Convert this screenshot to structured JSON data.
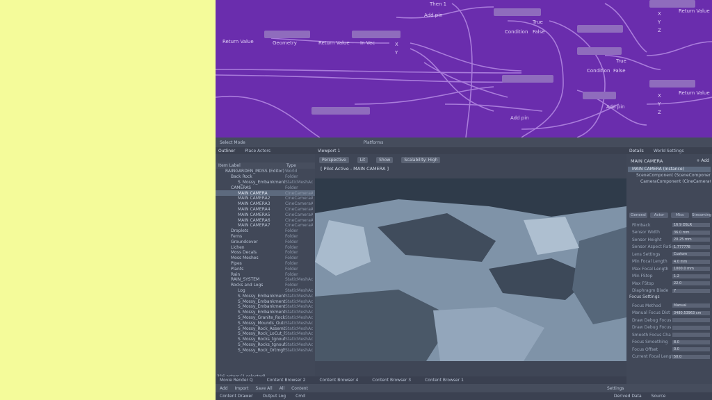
{
  "graph": {
    "nodes": [
      "Then 1",
      "Add pin",
      "Return Value",
      "Geometry",
      "Return Value",
      "In Vec",
      "X",
      "Y",
      "True",
      "Condition",
      "False",
      "True",
      "Condition",
      "False",
      "Add pin",
      "Add pin",
      "Return Value",
      "Return Value",
      "X",
      "Y",
      "Z",
      "X",
      "Y",
      "Z"
    ]
  },
  "toolbar": {
    "select_mode": "Select Mode",
    "platforms": "Platforms"
  },
  "outliner": {
    "tab_outliner": "Outliner",
    "tab_place": "Place Actors",
    "col_label": "Item Label",
    "col_type": "Type",
    "rows": [
      {
        "name": "RAINGARDEN_MOSS (Editor)",
        "type": "World"
      },
      {
        "name": "Back Rock",
        "type": "Folder"
      },
      {
        "name": "S_Mossy_Embankment_Coastal",
        "type": "StaticMeshAct"
      },
      {
        "name": "CAMERAS",
        "type": "Folder"
      },
      {
        "name": "MAIN CAMERA",
        "type": "CineCameraAct"
      },
      {
        "name": "MAIN CAMERA2",
        "type": "CineCameraAct"
      },
      {
        "name": "MAIN CAMERA3",
        "type": "CineCameraAct"
      },
      {
        "name": "MAIN CAMERA4",
        "type": "CineCameraAct"
      },
      {
        "name": "MAIN CAMERA5",
        "type": "CineCameraAct"
      },
      {
        "name": "MAIN CAMERA6",
        "type": "CineCameraAct"
      },
      {
        "name": "MAIN CAMERA7",
        "type": "CineCameraAct"
      },
      {
        "name": "Droplets",
        "type": "Folder"
      },
      {
        "name": "Ferns",
        "type": "Folder"
      },
      {
        "name": "Groundcover",
        "type": "Folder"
      },
      {
        "name": "Lichen",
        "type": "Folder"
      },
      {
        "name": "Moss Decals",
        "type": "Folder"
      },
      {
        "name": "Moss Meshes",
        "type": "Folder"
      },
      {
        "name": "Pipes",
        "type": "Folder"
      },
      {
        "name": "Plants",
        "type": "Folder"
      },
      {
        "name": "Rain",
        "type": "Folder"
      },
      {
        "name": "RAIN_SYSTEM",
        "type": "StaticMeshAct"
      },
      {
        "name": "Rocks and Logs",
        "type": "Folder"
      },
      {
        "name": "Log",
        "type": "StaticMeshAct"
      },
      {
        "name": "S_Mossy_Embankment_01",
        "type": "StaticMeshAct"
      },
      {
        "name": "S_Mossy_Embankment_02",
        "type": "StaticMeshAct"
      },
      {
        "name": "S_Mossy_Embankment_03",
        "type": "StaticMeshAct"
      },
      {
        "name": "S_Mossy_Embankment_04",
        "type": "StaticMeshAct"
      },
      {
        "name": "S_Mossy_Granite_Rocks",
        "type": "StaticMeshAct"
      },
      {
        "name": "S_Mossy_Mounds_Outcrop",
        "type": "StaticMeshAct"
      },
      {
        "name": "S_Mossy_Rock_Assembly",
        "type": "StaticMeshAct"
      },
      {
        "name": "S_Mossy_Rock_LoCut_Rock",
        "type": "StaticMeshAct"
      },
      {
        "name": "S_Mossy_Rocks_tgnoufic",
        "type": "StaticMeshAct"
      },
      {
        "name": "S_Mossy_Rocks_tgnoufic",
        "type": "StaticMeshAct"
      },
      {
        "name": "S_Mossy_Rock_Ortmgfs",
        "type": "StaticMeshAct"
      }
    ],
    "footer": "316 actors (1 selected)"
  },
  "viewport": {
    "tab": "Viewport 1",
    "perspective": "Perspective",
    "lit": "Lit",
    "show": "Show",
    "scalability": "Scalability: High",
    "status": "[ Pilot Active - MAIN CAMERA ]"
  },
  "details": {
    "tab_details": "Details",
    "tab_world": "World Settings",
    "title": "MAIN CAMERA",
    "add": "+ Add",
    "components": [
      "MAIN CAMERA (Instance)",
      "SceneComponent (SceneComponent)",
      "CameraComponent (CineCameraComponent)"
    ],
    "tabs": [
      "General",
      "Actor",
      "Misc",
      "Streaming"
    ],
    "filmback_label": "Filmback",
    "props": [
      {
        "label": "Filmback",
        "value": "16:9 DSLR"
      },
      {
        "label": "Sensor Width",
        "value": "36.0 mm"
      },
      {
        "label": "Sensor Height",
        "value": "20.25 mm"
      },
      {
        "label": "Sensor Aspect Ratio",
        "value": "1.777778"
      },
      {
        "label": "Lens Settings",
        "value": "Custom"
      },
      {
        "label": "Min Focal Length",
        "value": "4.0 mm"
      },
      {
        "label": "Max Focal Length",
        "value": "1000.0 mm"
      },
      {
        "label": "Min FStop",
        "value": "1.2"
      },
      {
        "label": "Max FStop",
        "value": "22.0"
      },
      {
        "label": "Diaphragm Blade",
        "value": "7"
      }
    ],
    "focus_section": "Focus Settings",
    "focus_props": [
      {
        "label": "Focus Method",
        "value": "Manual"
      },
      {
        "label": "Manual Focus Dist",
        "value": "3480.53963 cm"
      },
      {
        "label": "Draw Debug Focus",
        "value": ""
      },
      {
        "label": "Draw Debug Focus",
        "value": ""
      },
      {
        "label": "Smooth Focus Cha",
        "value": ""
      },
      {
        "label": "Focus Smoothing",
        "value": "8.0"
      },
      {
        "label": "Focus Offset",
        "value": "0.0"
      },
      {
        "label": "Current Focal Length",
        "value": "50.0"
      }
    ]
  },
  "drawers": [
    "Movie Render Q",
    "Content Browser 2",
    "Content Browser 4",
    "Content Browser 3",
    "Content Browser 1"
  ],
  "content_bar": {
    "add": "Add",
    "import": "Import",
    "save_all": "Save All",
    "all": "All",
    "content": "Content",
    "settings": "Settings"
  },
  "status": {
    "content_drawer": "Content Drawer",
    "output_log": "Output Log",
    "cmd": "Cmd",
    "derived_data": "Derived Data",
    "source": "Source"
  }
}
